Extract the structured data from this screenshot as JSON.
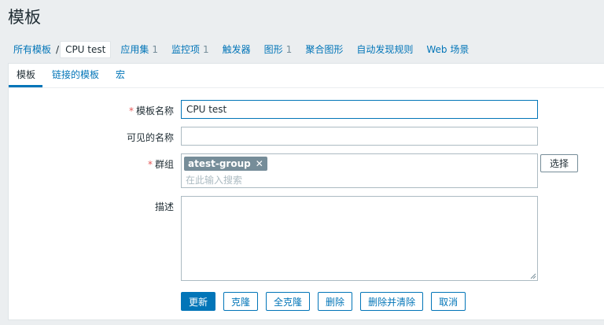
{
  "page": {
    "title": "模板"
  },
  "subnav": {
    "breadcrumb_root": "所有模板",
    "separator": "/",
    "current": "CPU test",
    "items": [
      {
        "label": "应用集",
        "count": "1"
      },
      {
        "label": "监控项",
        "count": "1"
      },
      {
        "label": "触发器",
        "count": ""
      },
      {
        "label": "图形",
        "count": "1"
      },
      {
        "label": "聚合图形",
        "count": ""
      },
      {
        "label": "自动发现规则",
        "count": ""
      },
      {
        "label": "Web 场景",
        "count": ""
      }
    ]
  },
  "tabs": [
    {
      "label": "模板",
      "active": true
    },
    {
      "label": "链接的模板",
      "active": false
    },
    {
      "label": "宏",
      "active": false
    }
  ],
  "form": {
    "template_name": {
      "label": "模板名称",
      "required": "*",
      "value": "CPU test"
    },
    "visible_name": {
      "label": "可见的名称",
      "value": ""
    },
    "groups": {
      "label": "群组",
      "required": "*",
      "tags": [
        "atest-group"
      ],
      "remove_glyph": "✕",
      "search_placeholder": "在此输入搜索",
      "select_label": "选择"
    },
    "description": {
      "label": "描述",
      "value": ""
    }
  },
  "buttons": {
    "update": "更新",
    "clone": "克隆",
    "full_clone": "全克隆",
    "delete": "删除",
    "delete_and_clear": "删除并清除",
    "cancel": "取消"
  },
  "colors": {
    "accent": "#0275b8",
    "required": "#e45959",
    "tag_bg": "#768d99",
    "page_bg": "#ebeef0"
  }
}
